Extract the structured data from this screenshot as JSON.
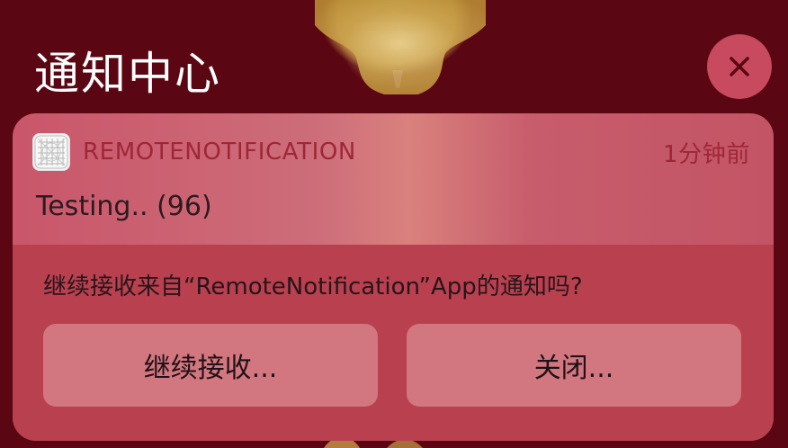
{
  "notification_center": {
    "title": "通知中心",
    "close_icon": "close-icon"
  },
  "notification": {
    "app_name": "REMOTENOTIFICATION",
    "time": "1分钟前",
    "message": "Testing.. (96)",
    "prompt": "继续接收来自“RemoteNotification”App的通知吗?",
    "buttons": {
      "continue_label": "继续接收...",
      "close_label": "关闭..."
    }
  },
  "colors": {
    "wallpaper": "#5b0613",
    "card_accent": "#9e2737",
    "close_button": "#c84a5e"
  }
}
